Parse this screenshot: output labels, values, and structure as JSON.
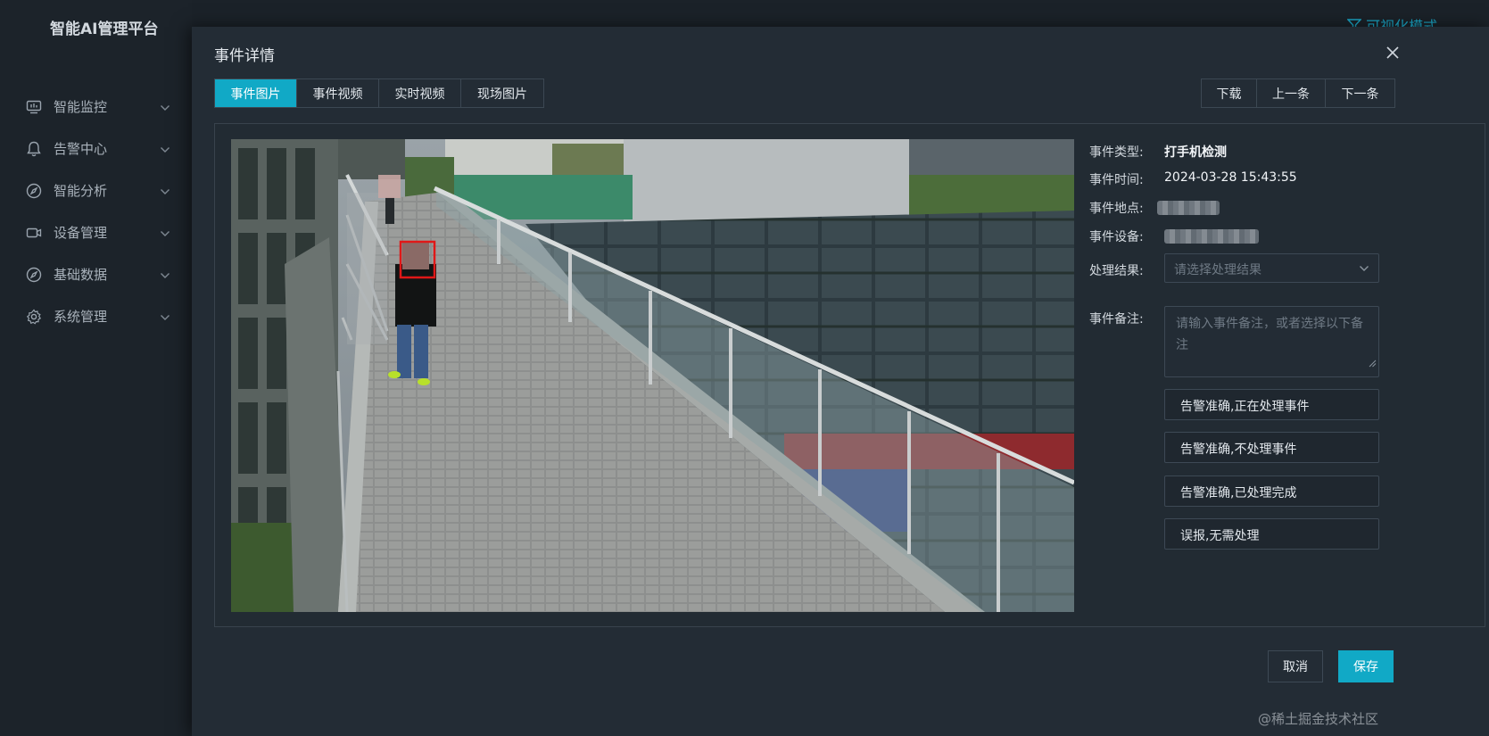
{
  "app": {
    "title": "智能AI管理平台",
    "mode_link": "可视化模式"
  },
  "sidebar": {
    "items": [
      {
        "label": "智能监控",
        "icon": "monitor-icon"
      },
      {
        "label": "告警中心",
        "icon": "bell-icon"
      },
      {
        "label": "智能分析",
        "icon": "compass-icon"
      },
      {
        "label": "设备管理",
        "icon": "camera-icon"
      },
      {
        "label": "基础数据",
        "icon": "compass-icon"
      },
      {
        "label": "系统管理",
        "icon": "gear-icon"
      }
    ]
  },
  "modal": {
    "title": "事件详情",
    "close_icon": "close-icon",
    "tabs": [
      {
        "label": "事件图片",
        "active": true
      },
      {
        "label": "事件视频",
        "active": false
      },
      {
        "label": "实时视频",
        "active": false
      },
      {
        "label": "现场图片",
        "active": false
      }
    ],
    "nav": {
      "download": "下载",
      "prev": "上一条",
      "next": "下一条"
    },
    "details": {
      "type_label": "事件类型:",
      "type_value": "打手机检测",
      "time_label": "事件时间:",
      "time_value": "2024-03-28 15:43:55",
      "location_label": "事件地点:",
      "device_label": "事件设备:",
      "result_label": "处理结果:",
      "result_placeholder": "请选择处理结果",
      "remark_label": "事件备注:",
      "remark_placeholder": "请输入事件备注，或者选择以下备注"
    },
    "quick_remarks": [
      "告警准确,正在处理事件",
      "告警准确,不处理事件",
      "告警准确,已处理完成",
      "误报,无需处理"
    ],
    "footer": {
      "cancel": "取消",
      "save": "保存"
    }
  },
  "watermark": "@稀土掘金技术社区",
  "colors": {
    "accent": "#11a9c6",
    "detection_box": "#e01818",
    "background": "#232c35"
  }
}
